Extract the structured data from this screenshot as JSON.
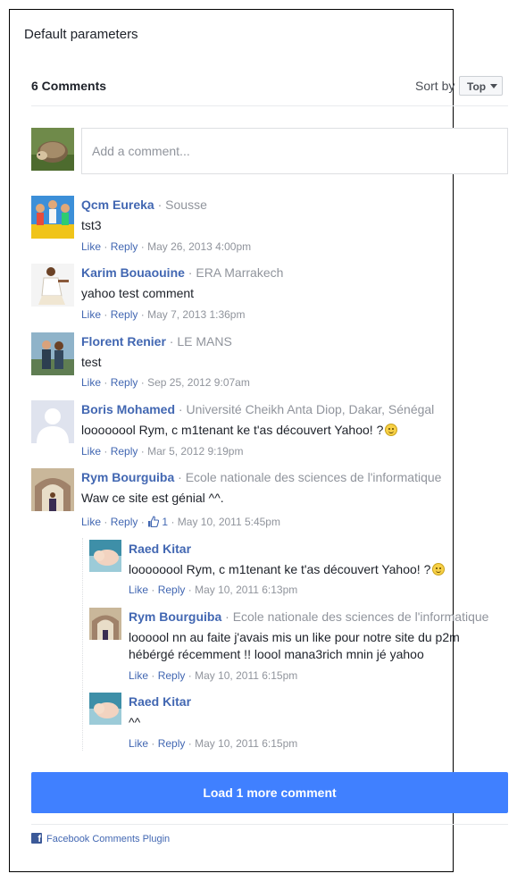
{
  "panel_title": "Default parameters",
  "header": {
    "count_label": "6 Comments",
    "sort_label": "Sort by",
    "sort_value": "Top"
  },
  "composer": {
    "placeholder": "Add a comment..."
  },
  "actions": {
    "like": "Like",
    "reply": "Reply",
    "separator": "·"
  },
  "comments": [
    {
      "author": "Qcm Eureka",
      "affiliation": "Sousse",
      "text": "tst3",
      "time": "May 26, 2013 4:00pm",
      "avatar": "group-photo"
    },
    {
      "author": "Karim Bouaouine",
      "affiliation": "ERA Marrakech",
      "text": "yahoo test comment",
      "time": "May 7, 2013 1:36pm",
      "avatar": "dancer-photo"
    },
    {
      "author": "Florent Renier",
      "affiliation": "LE MANS",
      "text": "test",
      "time": "Sep 25, 2012 9:07am",
      "avatar": "couple-photo"
    },
    {
      "author": "Boris Mohamed",
      "affiliation": "Université Cheikh Anta Diop, Dakar, Sénégal",
      "text": "loooooool Rym, c m1tenant ke t'as découvert Yahoo! ?",
      "time": "Mar 5, 2012 9:19pm",
      "avatar": "default-silhouette",
      "emoji": "smile"
    },
    {
      "author": "Rym Bourguiba",
      "affiliation": "Ecole nationale des sciences de l'informatique",
      "text": "Waw ce site est génial ^^.",
      "time": "May 10, 2011 5:45pm",
      "avatar": "building-photo",
      "like_count": "1"
    }
  ],
  "replies": [
    {
      "author": "Raed Kitar",
      "affiliation": "",
      "text": "loooooool Rym, c m1tenant ke t'as découvert Yahoo! ?",
      "time": "May 10, 2011 6:13pm",
      "avatar": "baby-photo",
      "emoji": "smile"
    },
    {
      "author": "Rym Bourguiba",
      "affiliation": "Ecole nationale des sciences de l'informatique",
      "text": "loooool nn au faite j'avais mis un like pour notre site du p2m hébérgé récemment !! loool mana3rich mnin jé yahoo",
      "time": "May 10, 2011 6:15pm",
      "avatar": "building-photo"
    },
    {
      "author": "Raed Kitar",
      "affiliation": "",
      "text": "^^",
      "time": "May 10, 2011 6:15pm",
      "avatar": "baby-photo"
    }
  ],
  "load_more": "Load 1 more comment",
  "footer": "Facebook Comments Plugin",
  "colors": {
    "link": "#4267b2",
    "meta": "#90949c",
    "button": "#4080ff"
  }
}
